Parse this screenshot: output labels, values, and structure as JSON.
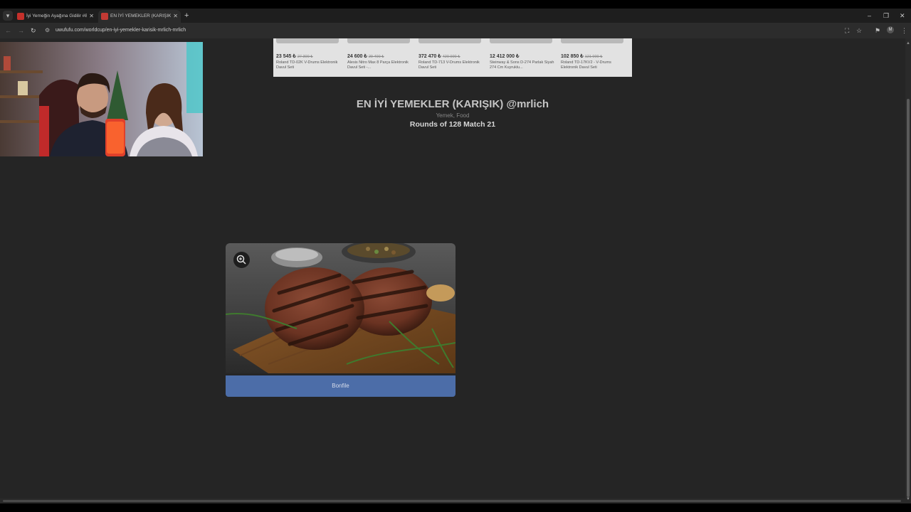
{
  "browser": {
    "tabs": [
      {
        "title": "İyi Yemeğin Ayağına Gidilir #8 |",
        "favicon": "youtube-icon",
        "active": false,
        "accent": "#c4302b"
      },
      {
        "title": "EN İYİ YEMEKLER (KARIŞIK) @mrlich",
        "favicon": "uwufufu-icon",
        "active": true,
        "accent": "#c33a34"
      }
    ],
    "tab_menu_icon": "chevron-down-icon",
    "new_tab_icon": "plus-icon",
    "url": "uwufufu.com/worldcup/en-iyi-yemekler-karisik-mrlich-mrlich",
    "profile_initial": "M"
  },
  "ad": {
    "items": [
      {
        "price": "23 545 ₺",
        "old_price": "27 300 ₺",
        "name": "Roland TD-02K V-Drums Elektronik Davul Seti"
      },
      {
        "price": "24 600 ₺",
        "old_price": "29 400 ₺",
        "name": "Alesis Nitro Max 8 Parça Elektronik Davul Seti -..."
      },
      {
        "price": "372 470 ₺",
        "old_price": "420 000 ₺",
        "name": "Roland TD-713 V-Drums Elektronik Davul Seti"
      },
      {
        "price": "12 412 000 ₺",
        "old_price": "",
        "name": "Steinway & Sons D-274 Parlak Siyah 274 Cm Kuyruklu..."
      },
      {
        "price": "102 850 ₺",
        "old_price": "121 000 ₺",
        "name": "Roland TD-17KV2 - V-Drums Elektronik Davul Seti"
      }
    ]
  },
  "page": {
    "title": "EN İYİ YEMEKLER (KARIŞIK) @mrlich",
    "tags": "Yemek, Food",
    "round": "Rounds of 128 Match 21"
  },
  "candidate": {
    "label": "Bonfile",
    "zoom_icon": "zoom-in-icon",
    "button_color": "#4c6da8"
  }
}
